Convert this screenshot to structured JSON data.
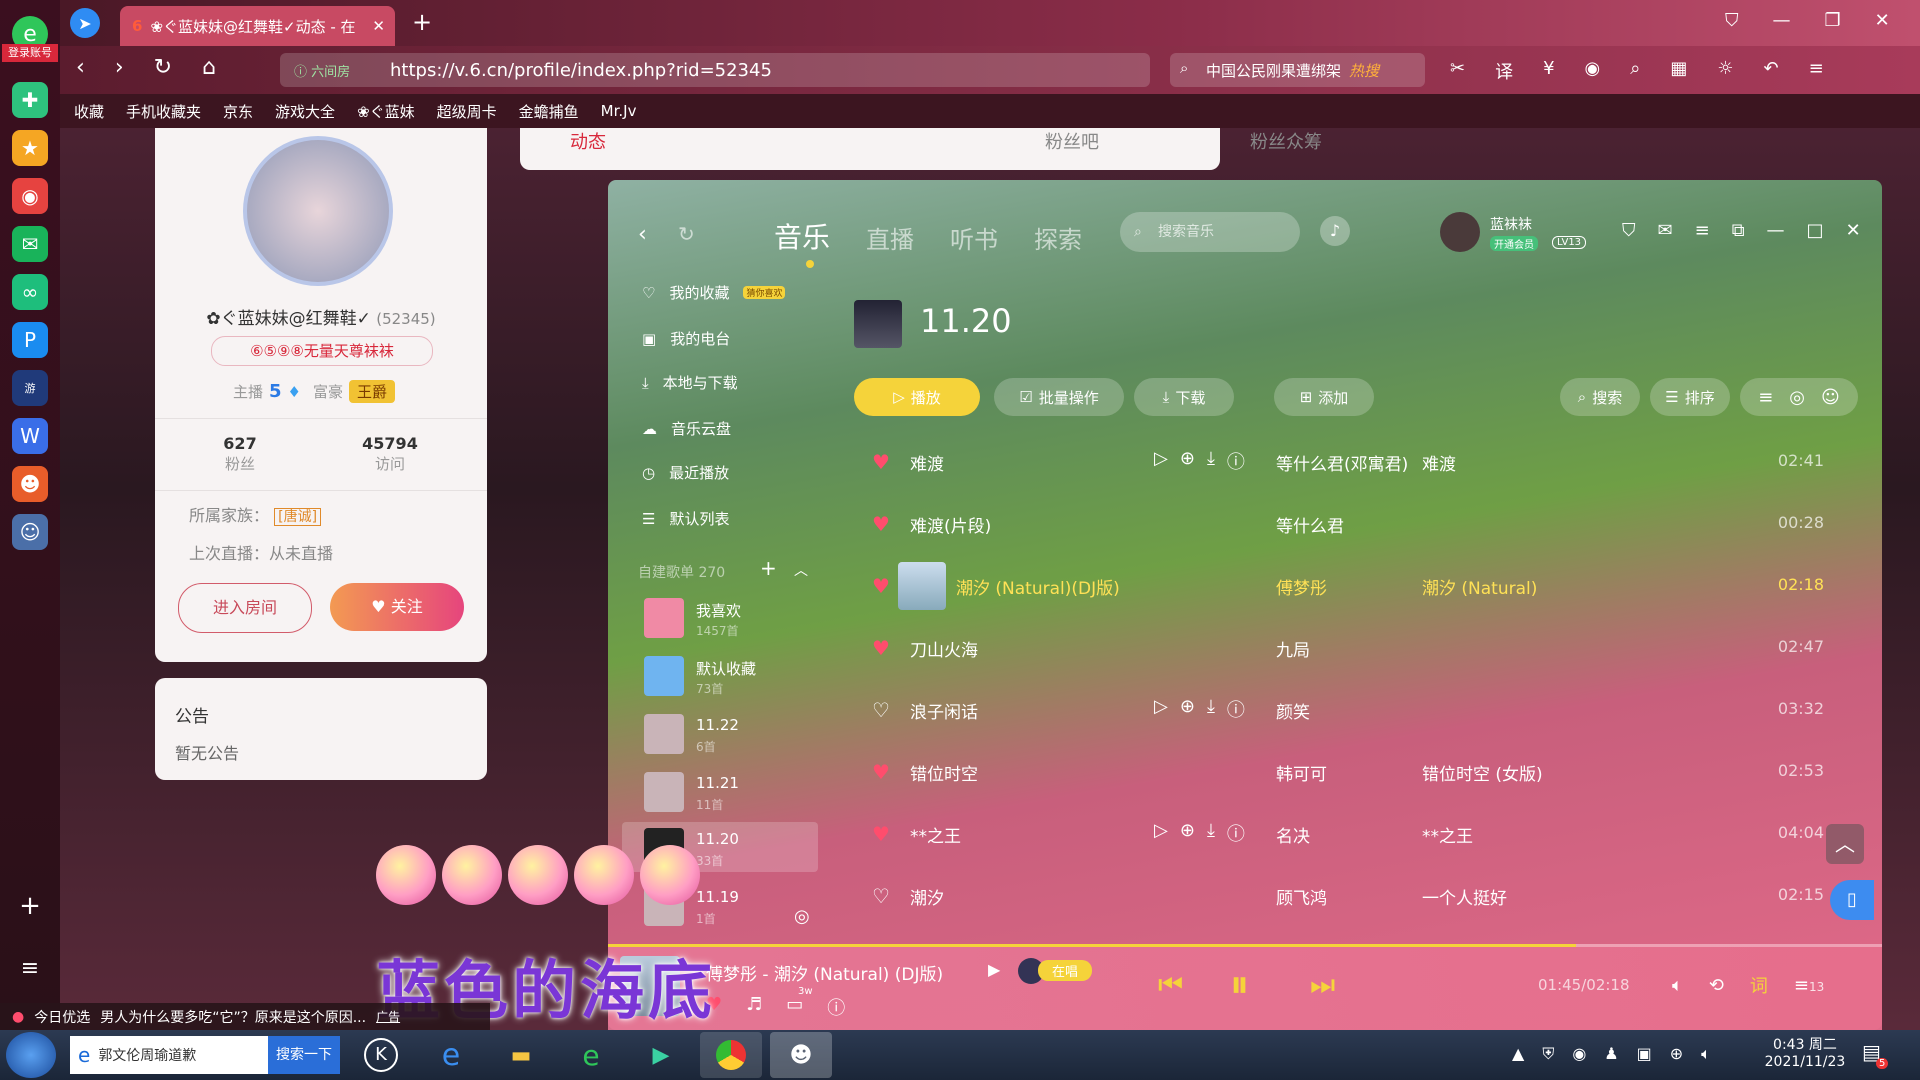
{
  "dock": {
    "login_label": "登录账号"
  },
  "browser": {
    "tab_title": "❀ぐ蓝妹妹@红舞鞋✓动态 - 在",
    "url_prefix": "ⓘ 六间房",
    "url": "https://v.6.cn/profile/index.php?rid=52345",
    "search_text": "中国公民刚果遭绑架",
    "search_badge": "热搜"
  },
  "bookmarks": [
    "收藏",
    "手机收藏夹",
    "京东",
    "游戏大全",
    "❀ぐ蓝妹",
    "超级周卡",
    "金蟾捕鱼",
    "Mr.Jv"
  ],
  "page_tabs": {
    "dynamic": "动态",
    "fans": "粉丝吧",
    "fans_group": "粉丝众筹"
  },
  "profile": {
    "name": "✿ぐ蓝妹妹@红舞鞋✓",
    "uid": "(52345)",
    "badge": "⑥⑤⑨⑧无量天尊袜袜",
    "anchor_label": "主播",
    "anchor_level": "5",
    "rich_label": "富豪",
    "rich_title": "王爵",
    "fans_count": "627",
    "fans_label": "粉丝",
    "visits_count": "45794",
    "visits_label": "访问",
    "family_label": "所属家族：",
    "family_value": "[唐诚]",
    "last_live": "上次直播：从未直播",
    "enter_room": "进入房间",
    "follow": "关注"
  },
  "notice": {
    "title": "公告",
    "body": "暂无公告"
  },
  "music": {
    "tabs": [
      "音乐",
      "直播",
      "听书",
      "探索"
    ],
    "search_placeholder": "搜索音乐",
    "username": "蓝袜袜",
    "vip_label": "开通会员",
    "level": "LV13",
    "nav": [
      {
        "label": "我的收藏",
        "tag": "猜你喜欢"
      },
      {
        "label": "我的电台"
      },
      {
        "label": "本地与下载"
      },
      {
        "label": "音乐云盘"
      },
      {
        "label": "最近播放"
      },
      {
        "label": "默认列表"
      }
    ],
    "custom_header": "自建歌单 270",
    "playlists": [
      {
        "name": "我喜欢",
        "count": "1457首",
        "color": "#f08aa5"
      },
      {
        "name": "默认收藏",
        "count": "73首",
        "color": "#6fb4f0"
      },
      {
        "name": "11.22",
        "count": "6首",
        "color": "#c9b4b8"
      },
      {
        "name": "11.21",
        "count": "11首",
        "color": "#c9b4b8"
      },
      {
        "name": "11.20",
        "count": "33首",
        "color": "#222222"
      },
      {
        "name": "11.19",
        "count": "1首",
        "color": "#c9b4b8"
      }
    ],
    "current_list": "11.20",
    "toolbar": {
      "play": "播放",
      "batch": "批量操作",
      "download": "下载",
      "add": "添加",
      "search": "搜索",
      "sort": "排序"
    },
    "songs": [
      {
        "title": "难渡",
        "artist": "等什么君(邓寓君)",
        "album": "难渡",
        "duration": "02:41",
        "liked": true
      },
      {
        "title": "难渡(片段)",
        "artist": "等什么君",
        "album": "",
        "duration": "00:28",
        "liked": true
      },
      {
        "title": "潮汐 (Natural)(DJ版)",
        "artist": "傅梦彤",
        "album": "潮汐 (Natural)",
        "duration": "02:18",
        "liked": true
      },
      {
        "title": "刀山火海",
        "artist": "九局",
        "album": "",
        "duration": "02:47",
        "liked": true
      },
      {
        "title": "浪子闲话",
        "artist": "颜笑",
        "album": "",
        "duration": "03:32",
        "liked": false
      },
      {
        "title": "错位时空",
        "artist": "韩可可",
        "album": "错位时空 (女版)",
        "duration": "02:53",
        "liked": true
      },
      {
        "title": "**之王",
        "artist": "名决",
        "album": "**之王",
        "duration": "04:04",
        "liked": true
      },
      {
        "title": "潮汐",
        "artist": "顾飞鸿",
        "album": "一个人挺好",
        "duration": "02:15",
        "liked": false
      }
    ],
    "player": {
      "now_playing": "傅梦彤 - 潮汐 (Natural) (DJ版)",
      "singing": "在唱",
      "progress_text": "01:45/02:18",
      "progress": 0.76,
      "lyrics_btn": "词",
      "queue_count": "13",
      "comment_count": "3w"
    }
  },
  "overlay_caption": "蓝色的海底",
  "ticker": {
    "label": "今日优选",
    "text": "男人为什么要多吃“它”？原来是这个原因...",
    "ad": "广告"
  },
  "taskbar": {
    "ie_label": "郭文伦周瑜道歉",
    "search_btn": "搜索一下",
    "time": "0:43 周二",
    "date": "2021/11/23",
    "notif_count": "5"
  },
  "colors": {
    "accent": "#f5d33a",
    "heart": "#ff4d6d",
    "current_song": "#ffe156"
  }
}
